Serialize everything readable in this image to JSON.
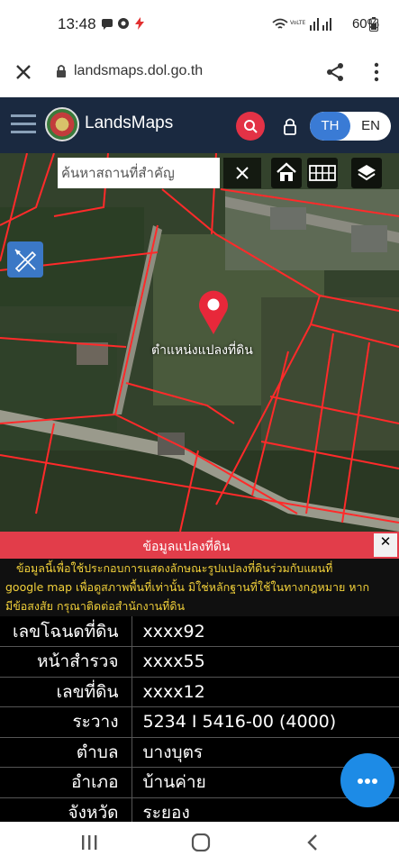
{
  "status_bar": {
    "time": "13:48",
    "battery": "60%",
    "icons": [
      "message-icon",
      "chat-icon",
      "flash-icon",
      "wifi-icon",
      "volte-icon",
      "signal-icon",
      "battery-icon"
    ]
  },
  "browser": {
    "url": "landsmaps.dol.go.th"
  },
  "header": {
    "title": "LandsMaps",
    "lang_th": "TH",
    "lang_en": "EN"
  },
  "map": {
    "search_placeholder": "ค้นหาสถานที่สำคัญ",
    "pin_label": "ตำแหน่งแปลงที่ดิน"
  },
  "parcel_panel": {
    "title": "ข้อมูลแปลงที่ดิน",
    "close": "✕",
    "disclaimer_1": "ข้อมูลนี้เพื่อใช้ประกอบการแสดงลักษณะรูปแปลงที่ดินร่วมกับแผนที่",
    "disclaimer_2": "google map เพื่อดูสภาพพื้นที่เท่านั้น มิใช่หลักฐานที่ใช้ในทางกฎหมาย หาก",
    "disclaimer_3": "มีข้อสงสัย กรุณาติดต่อสำนักงานที่ดิน",
    "rows": [
      {
        "label": "เลขโฉนดที่ดิน",
        "value": "xxxx92"
      },
      {
        "label": "หน้าสำรวจ",
        "value": "xxxx55"
      },
      {
        "label": "เลขที่ดิน",
        "value": "xxxx12"
      },
      {
        "label": "ระวาง",
        "value": "5234 I 5416-00 (4000)"
      },
      {
        "label": "ตำบล",
        "value": "บางบุตร"
      },
      {
        "label": "อำเภอ",
        "value": "บ้านค่าย"
      },
      {
        "label": "จังหวัด",
        "value": "ระยอง"
      }
    ]
  },
  "colors": {
    "header_bg": "#1a2940",
    "accent_red": "#e23d4a",
    "lang_active": "#3a7bd5",
    "fab": "#1d8be6",
    "disclaimer_text": "#f2d13a"
  }
}
